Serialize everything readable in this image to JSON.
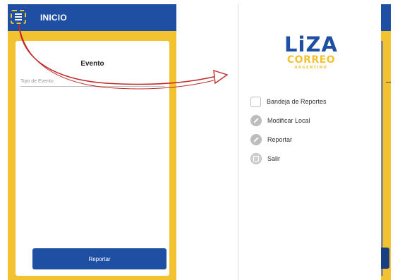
{
  "left_screen": {
    "appbar": {
      "title": "INICIO",
      "menu_icon": "hamburger-menu-icon"
    },
    "card": {
      "title": "Evento",
      "event_type_field": {
        "placeholder": "Tipo de Evento",
        "value": ""
      },
      "submit_label": "Reportar"
    }
  },
  "right_screen": {
    "logo": {
      "line1": "LiZA",
      "line2": "CORREO",
      "line3": "ARGENTINO"
    },
    "menu": [
      {
        "label": "Bandeja de Reportes",
        "icon": "folder-icon"
      },
      {
        "label": "Modificar Local",
        "icon": "pencil-icon"
      },
      {
        "label": "Reportar",
        "icon": "pencil-icon"
      },
      {
        "label": "Salir",
        "icon": "exit-icon"
      }
    ]
  },
  "colors": {
    "primary_blue": "#1f4fa3",
    "accent_yellow": "#f2c230",
    "arrow_red": "#c0292b"
  }
}
